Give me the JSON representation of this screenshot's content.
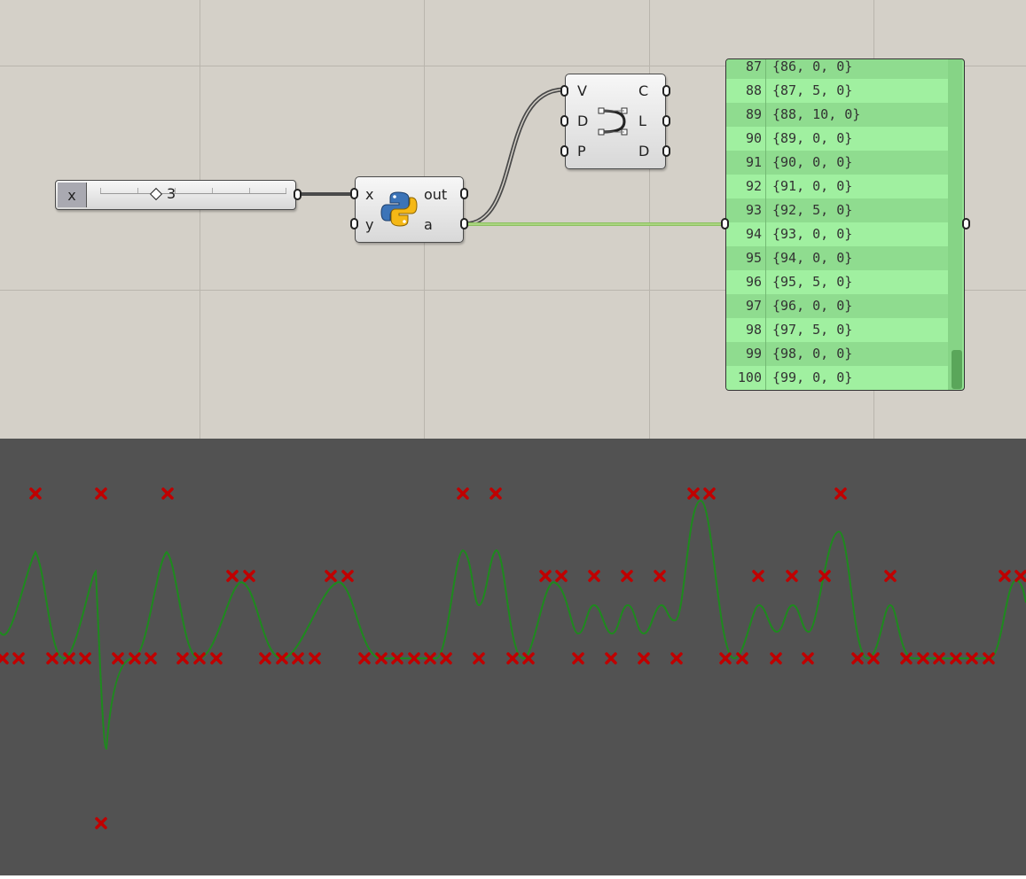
{
  "slider": {
    "name": "x",
    "value": "3"
  },
  "python_component": {
    "inputs": [
      "x",
      "y"
    ],
    "outputs": [
      "out",
      "a"
    ]
  },
  "curve_component": {
    "inputs": [
      "V",
      "D",
      "P"
    ],
    "outputs": [
      "C",
      "L",
      "D"
    ]
  },
  "panel": {
    "rows": [
      {
        "index": "87",
        "value": "{86, 0, 0}"
      },
      {
        "index": "88",
        "value": "{87, 5, 0}"
      },
      {
        "index": "89",
        "value": "{88, 10, 0}"
      },
      {
        "index": "90",
        "value": "{89, 0, 0}"
      },
      {
        "index": "91",
        "value": "{90, 0, 0}"
      },
      {
        "index": "92",
        "value": "{91, 0, 0}"
      },
      {
        "index": "93",
        "value": "{92, 5, 0}"
      },
      {
        "index": "94",
        "value": "{93, 0, 0}"
      },
      {
        "index": "95",
        "value": "{94, 0, 0}"
      },
      {
        "index": "96",
        "value": "{95, 5, 0}"
      },
      {
        "index": "97",
        "value": "{96, 0, 0}"
      },
      {
        "index": "98",
        "value": "{97, 5, 0}"
      },
      {
        "index": "99",
        "value": "{98, 0, 0}"
      },
      {
        "index": "100",
        "value": "{99, 0, 0}"
      }
    ]
  },
  "viewport": {
    "background": "#525252",
    "curve_color": "#1e8a1e",
    "point_color": "#c00000",
    "icons": [
      "point-cross-icon"
    ]
  }
}
